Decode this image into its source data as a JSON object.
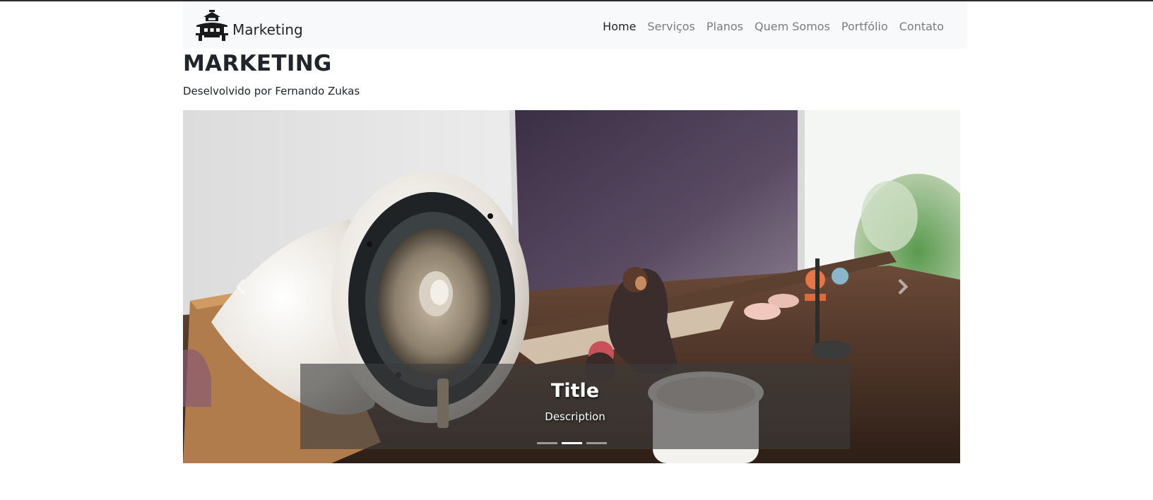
{
  "brand": {
    "label": "Marketing",
    "icon": "pagoda-icon"
  },
  "nav": {
    "items": [
      {
        "label": "Home",
        "active": true
      },
      {
        "label": "Serviços",
        "active": false
      },
      {
        "label": "Planos",
        "active": false
      },
      {
        "label": "Quem Somos",
        "active": false
      },
      {
        "label": "Portfólio",
        "active": false
      },
      {
        "label": "Contato",
        "active": false
      }
    ]
  },
  "header": {
    "title": "MARKETING",
    "subtitle": "Deselvolvido por Fernando Zukas"
  },
  "carousel": {
    "caption_title": "Title",
    "caption_description": "Description",
    "prev_icon": "chevron-left-icon",
    "next_icon": "chevron-right-icon",
    "slide_count": 3,
    "active_slide": 2
  },
  "colors": {
    "nav_background": "#f8f9fa",
    "nav_active": "#212529",
    "nav_inactive": "#7a7d80",
    "caption_overlay": "#3c3c3c"
  }
}
